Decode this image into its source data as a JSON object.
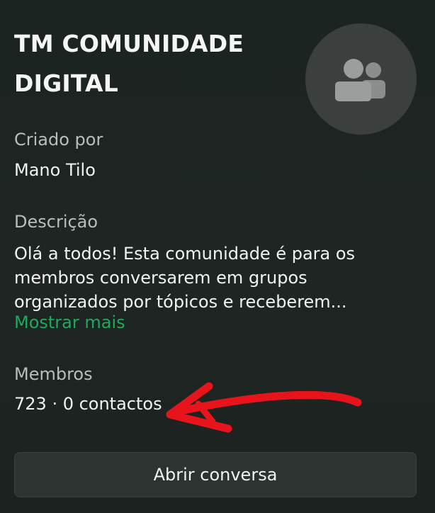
{
  "community": {
    "title_line1": "TM COMUNIDADE",
    "title_line2": "DIGITAL",
    "avatar_icon": "community-group-icon"
  },
  "created_by": {
    "label": "Criado por",
    "value": "Mano Tilo"
  },
  "description": {
    "label": "Descrição",
    "text": "Olá a todos! Esta comunidade é para os membros conversarem em grupos organizados por tópicos e receberem...",
    "show_more": "Mostrar mais"
  },
  "members": {
    "label": "Membros",
    "value": "723 · 0 contactos"
  },
  "actions": {
    "open_chat": "Abrir conversa"
  },
  "colors": {
    "background": "#1e2523",
    "accent_link": "#21a95b",
    "annotation_arrow": "#e8141c"
  }
}
